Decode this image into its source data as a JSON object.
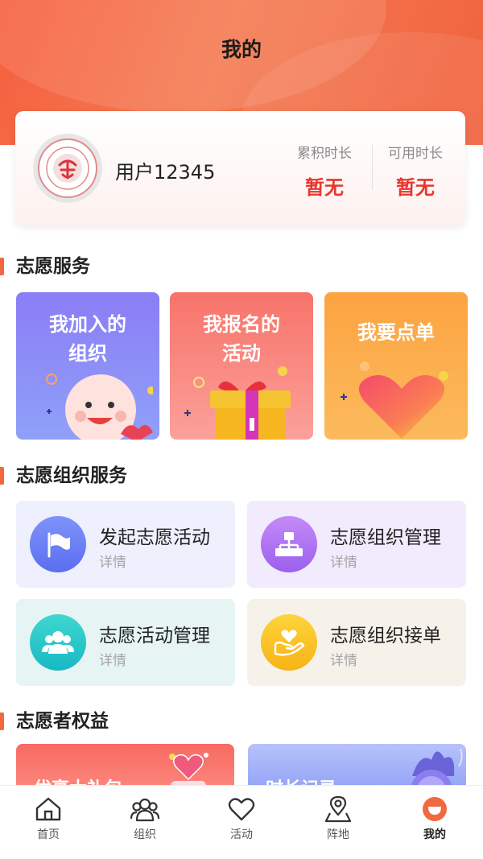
{
  "header": {
    "title": "我的"
  },
  "profile": {
    "username": "用户12345",
    "stats": [
      {
        "label": "累积时长",
        "value": "暂无"
      },
      {
        "label": "可用时长",
        "value": "暂无"
      }
    ]
  },
  "sections": {
    "volunteer_service": "志愿服务",
    "org_service": "志愿组织服务",
    "rights": "志愿者权益"
  },
  "service_cards": [
    {
      "label": "我加入的\n组织"
    },
    {
      "label": "我报名的\n活动"
    },
    {
      "label": "我要点单"
    }
  ],
  "org_tiles": [
    {
      "title": "发起志愿活动",
      "sub": "详情",
      "icon": "flag-icon"
    },
    {
      "title": "志愿组织管理",
      "sub": "详情",
      "icon": "org-chart-icon"
    },
    {
      "title": "志愿活动管理",
      "sub": "详情",
      "icon": "group-icon"
    },
    {
      "title": "志愿组织接单",
      "sub": "详情",
      "icon": "hand-heart-icon"
    }
  ],
  "rights_cards": [
    {
      "label": "优享大礼包"
    },
    {
      "label": "时长记录"
    }
  ],
  "tabbar": [
    {
      "label": "首页",
      "icon": "home-icon"
    },
    {
      "label": "组织",
      "icon": "people-icon"
    },
    {
      "label": "活动",
      "icon": "heart-icon"
    },
    {
      "label": "阵地",
      "icon": "map-pin-icon"
    },
    {
      "label": "我的",
      "icon": "profile-icon"
    }
  ],
  "colors": {
    "accent": "#f2683f",
    "stat_value": "#e8362d"
  }
}
